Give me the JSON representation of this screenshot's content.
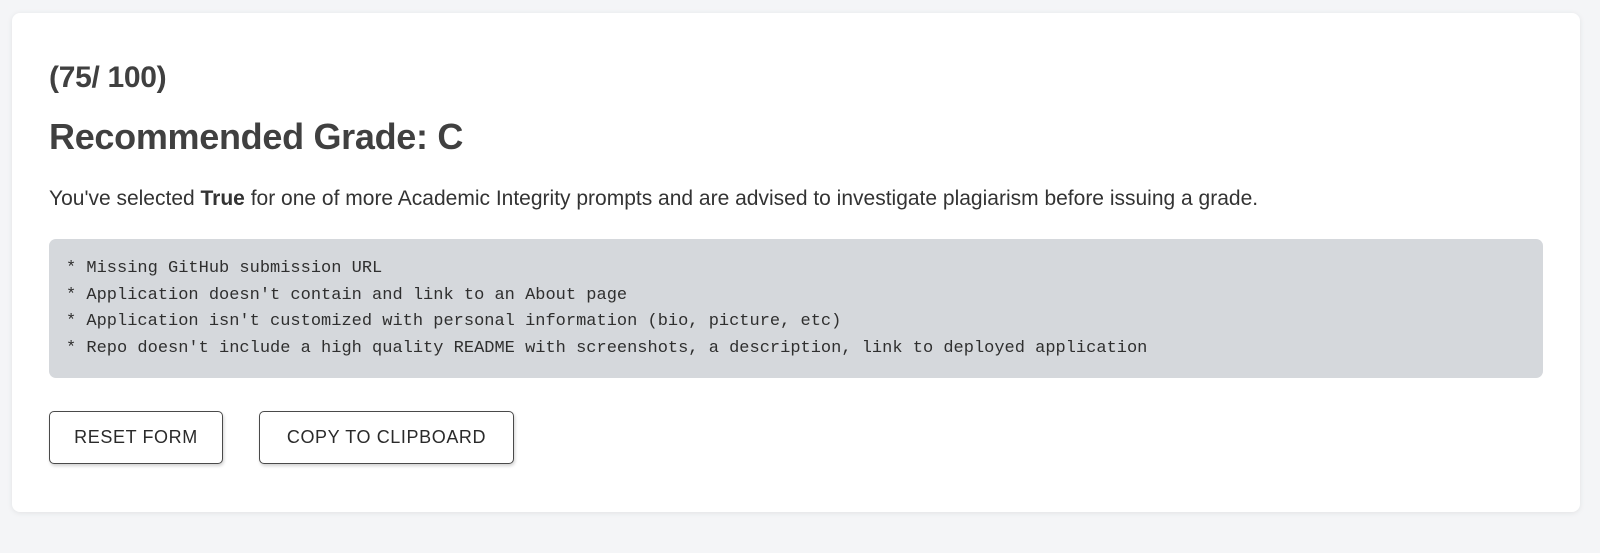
{
  "result": {
    "score": "(75/ 100)",
    "grade_title": "Recommended Grade: C",
    "notice_prefix": "You've selected ",
    "notice_bold": "True",
    "notice_suffix": " for one of more Academic Integrity prompts and are advised to investigate plagiarism before issuing a grade."
  },
  "feedback": {
    "lines": [
      "* Missing GitHub submission URL",
      "* Application doesn't contain and link to an About page",
      "* Application isn't customized with personal information (bio, picture, etc)",
      "* Repo doesn't include a high quality README with screenshots, a description, link to deployed application"
    ]
  },
  "actions": {
    "reset_label": "RESET FORM",
    "copy_label": "COPY TO CLIPBOARD"
  }
}
